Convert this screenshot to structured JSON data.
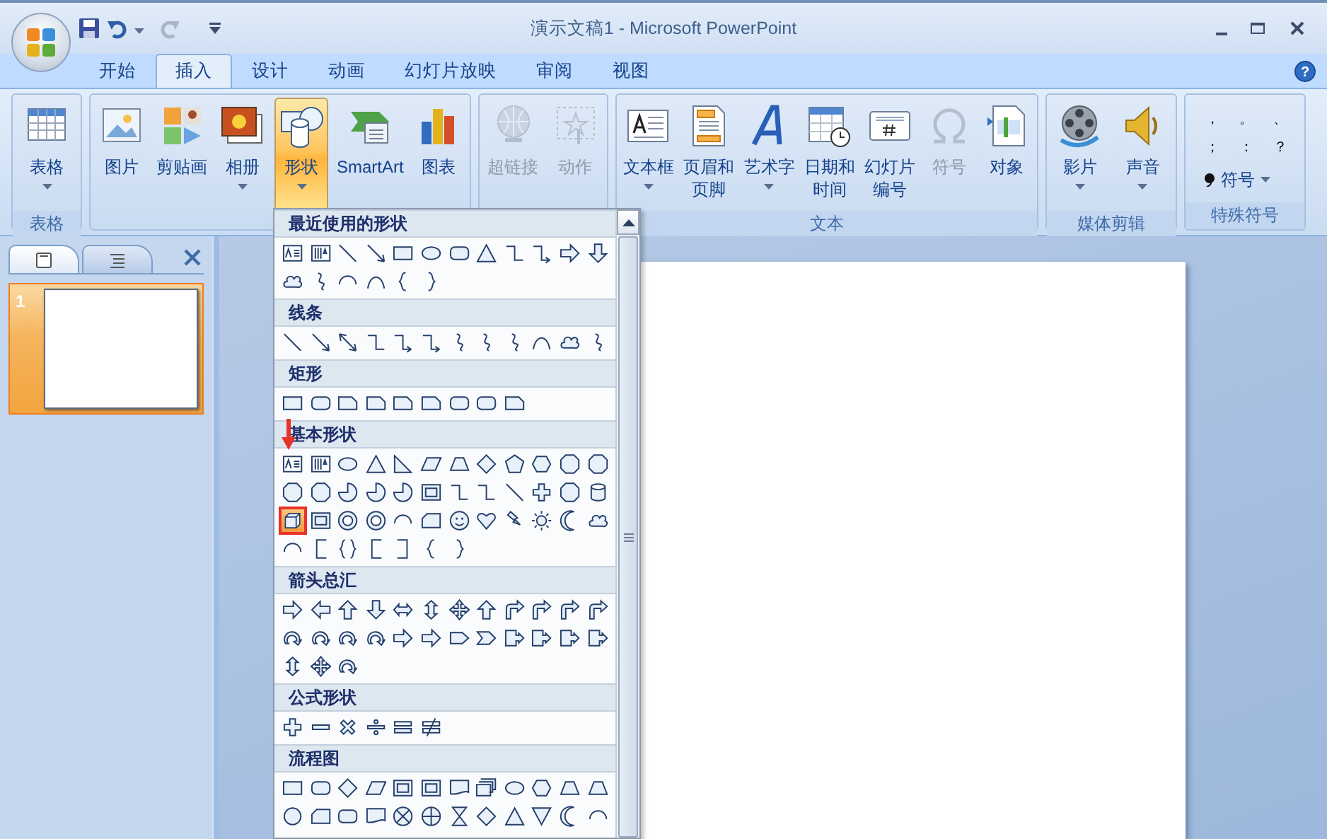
{
  "window": {
    "title": "演示文稿1 - Microsoft PowerPoint",
    "help": "?"
  },
  "ribbon_tabs": [
    {
      "label": "开始",
      "selected": false
    },
    {
      "label": "插入",
      "selected": true
    },
    {
      "label": "设计",
      "selected": false
    },
    {
      "label": "动画",
      "selected": false
    },
    {
      "label": "幻灯片放映",
      "selected": false
    },
    {
      "label": "审阅",
      "selected": false
    },
    {
      "label": "视图",
      "selected": false
    }
  ],
  "ribbon_groups": [
    {
      "label": "表格",
      "buttons": [
        {
          "label": [
            "表格"
          ],
          "dropdown": true,
          "disabled": false,
          "selected": false
        }
      ]
    },
    {
      "buttons": [
        {
          "label": [
            "图片"
          ],
          "dropdown": false,
          "disabled": false,
          "selected": false
        },
        {
          "label": [
            "剪贴画"
          ],
          "dropdown": false,
          "disabled": false,
          "selected": false
        },
        {
          "label": [
            "相册"
          ],
          "dropdown": true,
          "disabled": false,
          "selected": false
        },
        {
          "label": [
            "形状"
          ],
          "dropdown": true,
          "disabled": false,
          "selected": true
        },
        {
          "label": [
            "SmartArt"
          ],
          "dropdown": false,
          "disabled": false,
          "selected": false
        },
        {
          "label": [
            "图表"
          ],
          "dropdown": false,
          "disabled": false,
          "selected": false
        }
      ]
    },
    {
      "buttons": [
        {
          "label": [
            "超链接"
          ],
          "dropdown": false,
          "disabled": true,
          "selected": false
        },
        {
          "label": [
            "动作"
          ],
          "dropdown": false,
          "disabled": true,
          "selected": false
        }
      ]
    },
    {
      "label": "文本",
      "buttons": [
        {
          "label": [
            "文本框"
          ],
          "dropdown": true,
          "disabled": false,
          "selected": false
        },
        {
          "label": [
            "页眉和",
            "页脚"
          ],
          "dropdown": false,
          "disabled": false,
          "selected": false
        },
        {
          "label": [
            "艺术字"
          ],
          "dropdown": true,
          "disabled": false,
          "selected": false
        },
        {
          "label": [
            "日期和",
            "时间"
          ],
          "dropdown": false,
          "disabled": false,
          "selected": false
        },
        {
          "label": [
            "幻灯片",
            "编号"
          ],
          "dropdown": false,
          "disabled": false,
          "selected": false
        },
        {
          "label": [
            "符号"
          ],
          "dropdown": false,
          "disabled": true,
          "selected": false
        },
        {
          "label": [
            "对象"
          ],
          "dropdown": false,
          "disabled": false,
          "selected": false
        }
      ]
    },
    {
      "label": "媒体剪辑",
      "buttons": [
        {
          "label": [
            "影片"
          ],
          "dropdown": true,
          "disabled": false,
          "selected": false
        },
        {
          "label": [
            "声音"
          ],
          "dropdown": true,
          "disabled": false,
          "selected": false
        }
      ]
    },
    {
      "label": "特殊符号",
      "symbols": [
        "，",
        "。",
        "、",
        "；",
        "：",
        "？"
      ],
      "symbol_button": {
        "label": "符号",
        "dropdown": true
      }
    }
  ],
  "slide_pane": {
    "tabs": [
      {
        "selected": true
      },
      {
        "selected": false
      }
    ],
    "slides": [
      {
        "number": "1",
        "selected": true
      }
    ]
  },
  "shapes_menu": {
    "sections": [
      {
        "title": "最近使用的形状",
        "shapes": [
          {
            "selected": false
          },
          {
            "selected": false
          },
          {
            "selected": false
          },
          {
            "selected": false
          },
          {
            "selected": false
          },
          {
            "selected": false
          },
          {
            "selected": false
          },
          {
            "selected": false
          },
          {
            "selected": false
          },
          {
            "selected": false
          },
          {
            "selected": false
          },
          {
            "selected": false
          },
          {
            "selected": false
          },
          {
            "selected": false
          },
          {
            "selected": false
          },
          {
            "selected": false
          },
          {
            "selected": false
          },
          {
            "selected": false
          }
        ]
      },
      {
        "title": "线条",
        "shapes": [
          {
            "selected": false
          },
          {
            "selected": false
          },
          {
            "selected": false
          },
          {
            "selected": false
          },
          {
            "selected": false
          },
          {
            "selected": false
          },
          {
            "selected": false
          },
          {
            "selected": false
          },
          {
            "selected": false
          },
          {
            "selected": false
          },
          {
            "selected": false
          },
          {
            "selected": false
          }
        ]
      },
      {
        "title": "矩形",
        "shapes": [
          {
            "selected": false
          },
          {
            "selected": false
          },
          {
            "selected": false
          },
          {
            "selected": false
          },
          {
            "selected": false
          },
          {
            "selected": false
          },
          {
            "selected": false
          },
          {
            "selected": false
          },
          {
            "selected": false
          }
        ]
      },
      {
        "title": "基本形状",
        "shapes": [
          {
            "selected": false
          },
          {
            "selected": false
          },
          {
            "selected": false
          },
          {
            "selected": false
          },
          {
            "selected": false
          },
          {
            "selected": false
          },
          {
            "selected": false
          },
          {
            "selected": false
          },
          {
            "selected": false
          },
          {
            "selected": false
          },
          {
            "selected": false
          },
          {
            "selected": false
          },
          {
            "selected": false
          },
          {
            "selected": false
          },
          {
            "selected": false
          },
          {
            "selected": false
          },
          {
            "selected": false
          },
          {
            "selected": false
          },
          {
            "selected": false
          },
          {
            "selected": false
          },
          {
            "selected": false
          },
          {
            "selected": false
          },
          {
            "selected": false
          },
          {
            "selected": false
          },
          {
            "selected": true
          },
          {
            "selected": false
          },
          {
            "selected": false
          },
          {
            "selected": false
          },
          {
            "selected": false
          },
          {
            "selected": false
          },
          {
            "selected": false
          },
          {
            "selected": false
          },
          {
            "selected": false
          },
          {
            "selected": false
          },
          {
            "selected": false
          },
          {
            "selected": false
          },
          {
            "selected": false
          },
          {
            "selected": false
          },
          {
            "selected": false
          },
          {
            "selected": false
          },
          {
            "selected": false
          },
          {
            "selected": false
          },
          {
            "selected": false
          }
        ]
      },
      {
        "title": "箭头总汇",
        "shapes": [
          {
            "selected": false
          },
          {
            "selected": false
          },
          {
            "selected": false
          },
          {
            "selected": false
          },
          {
            "selected": false
          },
          {
            "selected": false
          },
          {
            "selected": false
          },
          {
            "selected": false
          },
          {
            "selected": false
          },
          {
            "selected": false
          },
          {
            "selected": false
          },
          {
            "selected": false
          },
          {
            "selected": false
          },
          {
            "selected": false
          },
          {
            "selected": false
          },
          {
            "selected": false
          },
          {
            "selected": false
          },
          {
            "selected": false
          },
          {
            "selected": false
          },
          {
            "selected": false
          },
          {
            "selected": false
          },
          {
            "selected": false
          },
          {
            "selected": false
          },
          {
            "selected": false
          },
          {
            "selected": false
          },
          {
            "selected": false
          },
          {
            "selected": false
          }
        ]
      },
      {
        "title": "公式形状",
        "shapes": [
          {
            "selected": false
          },
          {
            "selected": false
          },
          {
            "selected": false
          },
          {
            "selected": false
          },
          {
            "selected": false
          },
          {
            "selected": false
          }
        ]
      },
      {
        "title": "流程图",
        "shapes": [
          {
            "selected": false
          },
          {
            "selected": false
          },
          {
            "selected": false
          },
          {
            "selected": false
          },
          {
            "selected": false
          },
          {
            "selected": false
          },
          {
            "selected": false
          },
          {
            "selected": false
          },
          {
            "selected": false
          },
          {
            "selected": false
          },
          {
            "selected": false
          },
          {
            "selected": false
          },
          {
            "selected": false
          },
          {
            "selected": false
          },
          {
            "selected": false
          },
          {
            "selected": false
          },
          {
            "selected": false
          },
          {
            "selected": false
          },
          {
            "selected": false
          },
          {
            "selected": false
          },
          {
            "selected": false
          },
          {
            "selected": false
          },
          {
            "selected": false
          },
          {
            "selected": false
          }
        ]
      }
    ]
  }
}
